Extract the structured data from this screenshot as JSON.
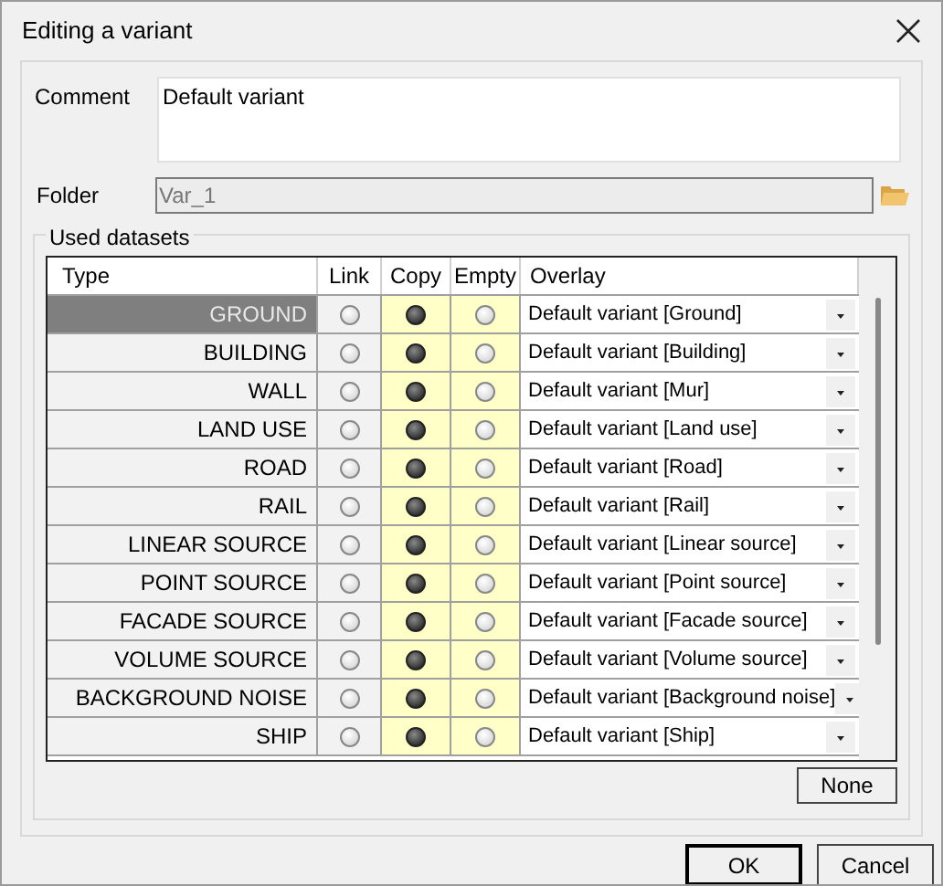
{
  "window": {
    "title": "Editing a variant"
  },
  "comment": {
    "label": "Comment",
    "value": "Default variant"
  },
  "folder": {
    "label": "Folder",
    "value": "Var_1",
    "disabled": true
  },
  "datasets": {
    "title": "Used datasets",
    "columns": [
      "Type",
      "Link",
      "Copy",
      "Empty",
      "Overlay"
    ],
    "rows": [
      {
        "type": "GROUND",
        "selected": true,
        "link": false,
        "copy": true,
        "empty": false,
        "overlay": "Default variant [Ground]"
      },
      {
        "type": "BUILDING",
        "selected": false,
        "link": false,
        "copy": true,
        "empty": false,
        "overlay": "Default variant [Building]"
      },
      {
        "type": "WALL",
        "selected": false,
        "link": false,
        "copy": true,
        "empty": false,
        "overlay": "Default variant [Mur]"
      },
      {
        "type": "LAND USE",
        "selected": false,
        "link": false,
        "copy": true,
        "empty": false,
        "overlay": "Default variant [Land use]"
      },
      {
        "type": "ROAD",
        "selected": false,
        "link": false,
        "copy": true,
        "empty": false,
        "overlay": "Default variant [Road]"
      },
      {
        "type": "RAIL",
        "selected": false,
        "link": false,
        "copy": true,
        "empty": false,
        "overlay": "Default variant [Rail]"
      },
      {
        "type": "LINEAR SOURCE",
        "selected": false,
        "link": false,
        "copy": true,
        "empty": false,
        "overlay": "Default variant [Linear source]"
      },
      {
        "type": "POINT SOURCE",
        "selected": false,
        "link": false,
        "copy": true,
        "empty": false,
        "overlay": "Default variant [Point source]"
      },
      {
        "type": "FACADE SOURCE",
        "selected": false,
        "link": false,
        "copy": true,
        "empty": false,
        "overlay": "Default variant [Facade source]"
      },
      {
        "type": "VOLUME SOURCE",
        "selected": false,
        "link": false,
        "copy": true,
        "empty": false,
        "overlay": "Default variant [Volume source]"
      },
      {
        "type": "BACKGROUND NOISE",
        "selected": false,
        "link": false,
        "copy": true,
        "empty": false,
        "overlay": "Default variant [Background noise]"
      },
      {
        "type": "SHIP",
        "selected": false,
        "link": false,
        "copy": true,
        "empty": false,
        "overlay": "Default variant [Ship]"
      }
    ],
    "none_button": "None"
  },
  "buttons": [
    "OK",
    "Cancel"
  ]
}
